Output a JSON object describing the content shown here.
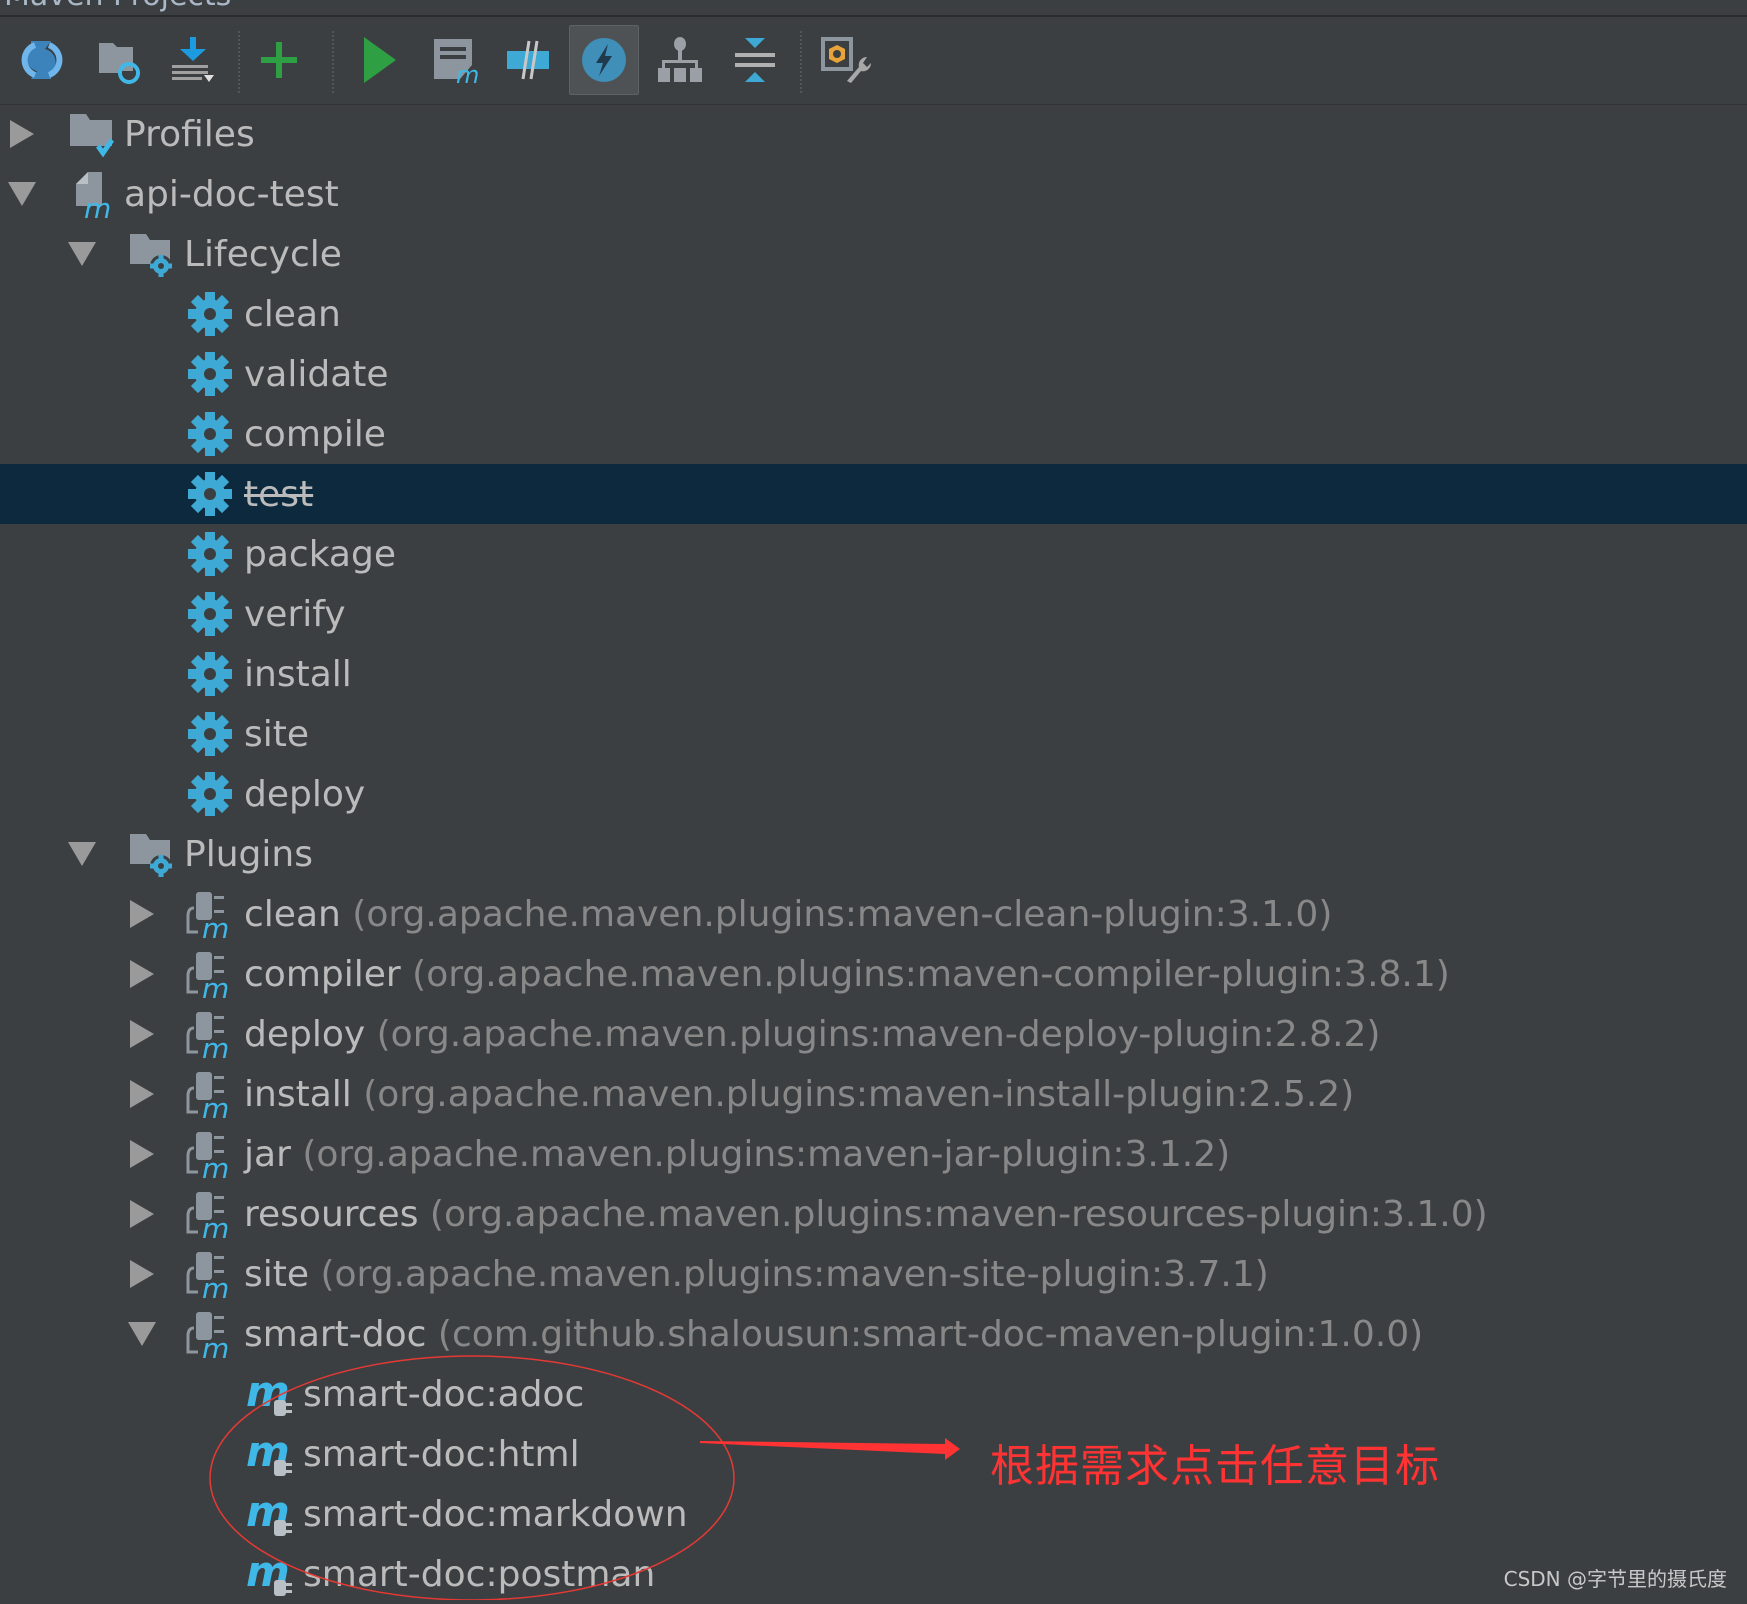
{
  "window": {
    "title": "Maven Projects"
  },
  "toolbar": {
    "buttons": [
      {
        "name": "reimport-all-button",
        "icon": "refresh-icon",
        "tooltip": "Reimport All Maven Projects"
      },
      {
        "name": "generate-sources-button",
        "icon": "folder-refresh-icon",
        "tooltip": "Generate Sources and Update Folders"
      },
      {
        "name": "download-sources-button",
        "icon": "download-icon",
        "tooltip": "Download Sources and/or Documentation"
      },
      {
        "name": "add-project-button",
        "icon": "plus-icon",
        "tooltip": "Add Maven Projects"
      },
      {
        "name": "run-build-button",
        "icon": "play-icon",
        "tooltip": "Run Maven Build"
      },
      {
        "name": "execute-goal-button",
        "icon": "maven-goal-icon",
        "tooltip": "Execute Maven Goal"
      },
      {
        "name": "toggle-offline-button",
        "icon": "offline-icon",
        "tooltip": "Toggle Offline Mode"
      },
      {
        "name": "skip-tests-button",
        "icon": "lightning-icon",
        "tooltip": "Toggle Skip Tests Mode",
        "active": true
      },
      {
        "name": "show-dependencies-button",
        "icon": "hierarchy-icon",
        "tooltip": "Show Dependencies"
      },
      {
        "name": "collapse-all-button",
        "icon": "collapse-icon",
        "tooltip": "Collapse All"
      },
      {
        "name": "settings-button",
        "icon": "maven-settings-icon",
        "tooltip": "Maven Settings"
      }
    ]
  },
  "tree": {
    "profiles": "Profiles",
    "project": "api-doc-test",
    "lifecycle": {
      "label": "Lifecycle",
      "phases": [
        "clean",
        "validate",
        "compile",
        "test",
        "package",
        "verify",
        "install",
        "site",
        "deploy"
      ],
      "selected": "test"
    },
    "plugins": {
      "label": "Plugins",
      "items": [
        {
          "name": "clean",
          "coords": "(org.apache.maven.plugins:maven-clean-plugin:3.1.0)"
        },
        {
          "name": "compiler",
          "coords": "(org.apache.maven.plugins:maven-compiler-plugin:3.8.1)"
        },
        {
          "name": "deploy",
          "coords": "(org.apache.maven.plugins:maven-deploy-plugin:2.8.2)"
        },
        {
          "name": "install",
          "coords": "(org.apache.maven.plugins:maven-install-plugin:2.5.2)"
        },
        {
          "name": "jar",
          "coords": "(org.apache.maven.plugins:maven-jar-plugin:3.1.2)"
        },
        {
          "name": "resources",
          "coords": "(org.apache.maven.plugins:maven-resources-plugin:3.1.0)"
        },
        {
          "name": "site",
          "coords": "(org.apache.maven.plugins:maven-site-plugin:3.7.1)"
        },
        {
          "name": "smart-doc",
          "coords": "(com.github.shalousun:smart-doc-maven-plugin:1.0.0)",
          "expanded": true
        }
      ],
      "goals": [
        "smart-doc:adoc",
        "smart-doc:html",
        "smart-doc:markdown",
        "smart-doc:postman"
      ]
    }
  },
  "annotation": {
    "text": "根据需求点击任意目标",
    "color": "#ff3333"
  },
  "watermark": "CSDN @字节里的摄氏度",
  "colors": {
    "background": "#3c3f41",
    "selection": "#0d293e",
    "accent_blue": "#3fa9d6",
    "run_green": "#2ea043"
  }
}
